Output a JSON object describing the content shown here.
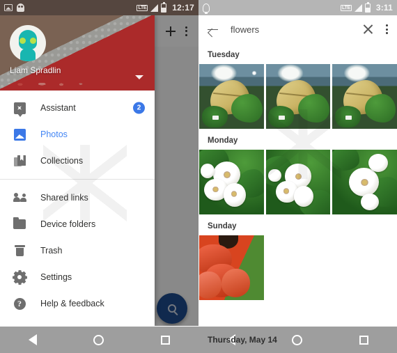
{
  "left_phone": {
    "status_bar": {
      "icons_left": [
        "screenshot-icon",
        "ghost-icon"
      ],
      "network": "LTE",
      "signal_icon": "signal-icon",
      "battery_icon": "battery-icon",
      "time": "12:17"
    },
    "drawer": {
      "user_name": "Liam Spradlin",
      "account_caret": "chevron-down-icon",
      "items": [
        {
          "label": "Assistant",
          "icon": "assistant-icon",
          "badge": "2",
          "active": false
        },
        {
          "label": "Photos",
          "icon": "photos-icon",
          "badge": "",
          "active": true
        },
        {
          "label": "Collections",
          "icon": "collections-icon",
          "badge": "",
          "active": false
        },
        {
          "label": "Shared links",
          "icon": "people-icon",
          "badge": "",
          "active": false
        },
        {
          "label": "Device folders",
          "icon": "folder-icon",
          "badge": "",
          "active": false
        },
        {
          "label": "Trash",
          "icon": "trash-icon",
          "badge": "",
          "active": false
        },
        {
          "label": "Settings",
          "icon": "gear-icon",
          "badge": "",
          "active": false
        },
        {
          "label": "Help & feedback",
          "icon": "help-icon",
          "badge": "",
          "active": false
        }
      ]
    },
    "fab": {
      "icon": "search-icon",
      "color": "#1e4b8f"
    },
    "nav_bar": {
      "back": "back-triangle-icon",
      "home": "home-circle-icon",
      "recents": "recents-square-icon"
    }
  },
  "right_phone": {
    "status_bar": {
      "icons_left": [
        "lightbulb-icon"
      ],
      "network": "LTE",
      "signal_icon": "signal-icon",
      "battery_icon": "battery-icon",
      "time": "3:11"
    },
    "search_bar": {
      "back_icon": "arrow-back-icon",
      "query": "flowers",
      "clear_icon": "close-icon",
      "overflow_icon": "more-vertical-icon"
    },
    "sections": [
      {
        "day": "Tuesday",
        "count": 3,
        "photo_kind": "yellow-leaf"
      },
      {
        "day": "Monday",
        "count": 3,
        "photo_kind": "white-flowers"
      },
      {
        "day": "Sunday",
        "count": 1,
        "photo_kind": "red-poppy"
      }
    ],
    "date_overlay": "Thursday, May 14",
    "nav_bar": {
      "back": "back-triangle-icon",
      "home": "home-circle-icon",
      "recents": "recents-square-icon"
    }
  },
  "colors": {
    "accent_blue": "#3b78e7",
    "drawer_red": "#ab2a2a",
    "fab_blue": "#1e4b8f"
  }
}
